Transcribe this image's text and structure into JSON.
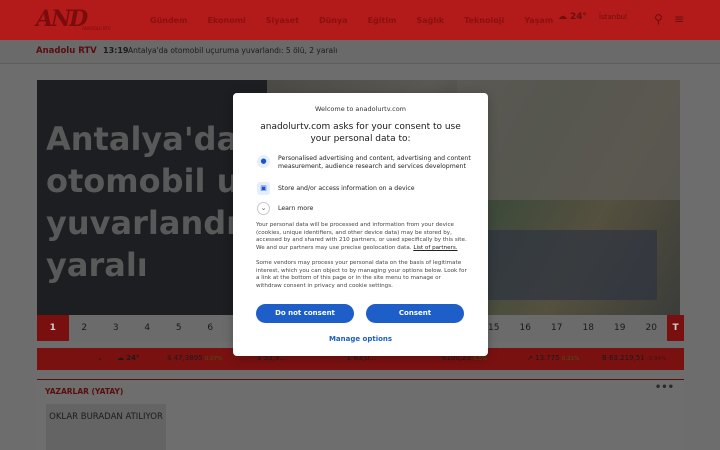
{
  "header": {
    "logo_text": "AND",
    "logo_sub": "ANADOLU RTV",
    "nav": [
      "Gündem",
      "Ekonomi",
      "Siyaset",
      "Dünya",
      "Eğitim",
      "Sağlık",
      "Teknoloji",
      "Yaşam"
    ],
    "weather_temp": "24°",
    "weather_city": "İstanbul",
    "weather_icon": "cloud-sun-icon",
    "search_icon": "search-icon",
    "menu_icon": "menu-icon"
  },
  "breaking": {
    "brand": "Anadolu RTV",
    "time": "13:19",
    "title": "Antalya'da otomobil uçuruma yuvarlandı: 5 ölü, 2 yaralı"
  },
  "hero": {
    "headline_lines": [
      "Antalya'da",
      "otomobil uç",
      "yuvarlandı:",
      "yaralı"
    ]
  },
  "pager": {
    "pages": [
      "1",
      "2",
      "3",
      "4",
      "5",
      "6",
      "",
      "",
      "",
      "",
      "",
      "",
      "",
      "",
      "15",
      "16",
      "17",
      "18",
      "19",
      "20"
    ],
    "active": "1",
    "last_label": "T"
  },
  "markets": {
    "weather_temp": "24°",
    "items": [
      {
        "symbol": "$",
        "value": "47,3895",
        "change": "0,07%"
      },
      {
        "symbol": "$",
        "value": "53,9...",
        "change": ""
      },
      {
        "symbol": "£",
        "value": "63,0...",
        "change": ""
      },
      {
        "symbol": "",
        "value": "6100,23",
        "change": "0,5%"
      },
      {
        "symbol": "",
        "value": "13.775",
        "change": "0,21%"
      },
      {
        "symbol": "B",
        "value": "63.219,51",
        "change": "-3,94%"
      }
    ]
  },
  "writers": {
    "heading": "YAZARLAR (YATAY)",
    "more": "•••",
    "card_text": "OKLAR BURADAN ATILIYOR"
  },
  "consent": {
    "welcome": "Welcome to anadolurtv.com",
    "heading": "anadolurtv.com asks for your consent to use your personal data to:",
    "purposes": [
      {
        "icon": "person-icon",
        "text": "Personalised advertising and content, advertising and content measurement, audience research and services development"
      },
      {
        "icon": "device-icon",
        "text": "Store and/or access information on a device"
      }
    ],
    "learn_more": "Learn more",
    "para1": "Your personal data will be processed and information from your device (cookies, unique identifiers, and other device data) may be stored by, accessed by and shared with 210 partners, or used specifically by this site. We and our partners may use precise geolocation data.",
    "partners_link": "List of partners.",
    "para2": "Some vendors may process your personal data on the basis of legitimate interest, which you can object to by managing your options below. Look for a link at the bottom of this page or in the site menu to manage or withdraw consent in privacy and cookie settings.",
    "do_not_consent": "Do not consent",
    "consent": "Consent",
    "manage": "Manage options"
  },
  "colors": {
    "brand_red": "#b31a1a",
    "dialog_button": "#1d5ec8"
  }
}
